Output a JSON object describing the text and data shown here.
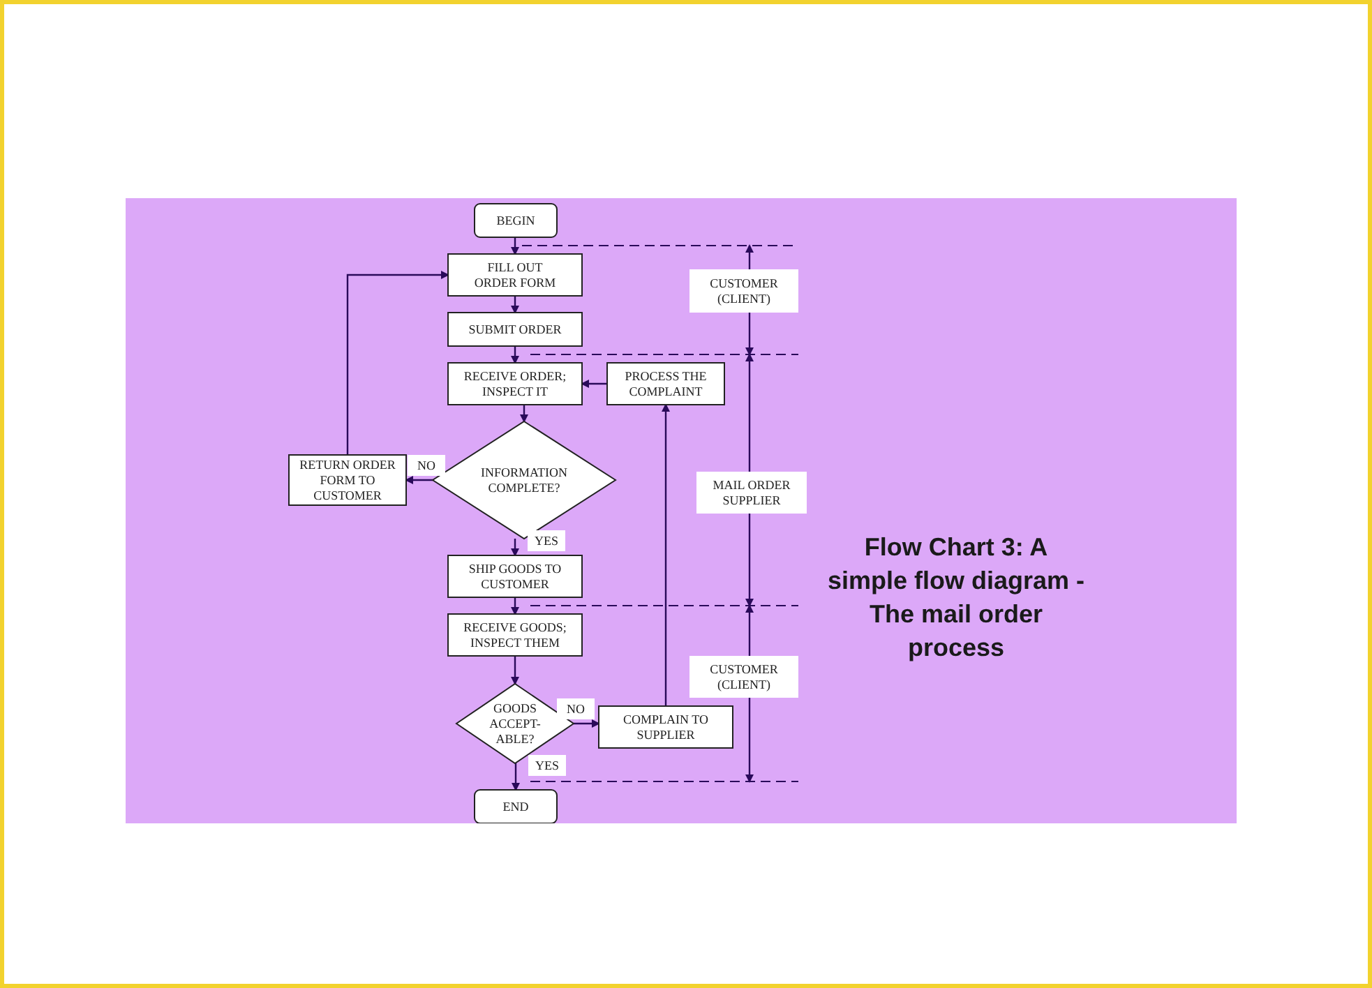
{
  "title": "Flow Chart 3:  A simple flow diagram - The mail order process",
  "nodes": [
    {
      "kind": "terminal",
      "lines": [
        "BEGIN"
      ]
    },
    {
      "kind": "process",
      "lines": [
        "FILL OUT",
        "ORDER FORM"
      ]
    },
    {
      "kind": "process",
      "lines": [
        "SUBMIT ORDER"
      ]
    },
    {
      "kind": "process",
      "lines": [
        "RECEIVE ORDER;",
        "INSPECT IT"
      ]
    },
    {
      "kind": "process",
      "lines": [
        "PROCESS THE",
        "COMPLAINT"
      ]
    },
    {
      "kind": "process",
      "lines": [
        "RETURN ORDER",
        "FORM TO",
        "CUSTOMER"
      ]
    },
    {
      "kind": "decision",
      "lines": [
        "INFORMATION",
        "COMPLETE?"
      ]
    },
    {
      "kind": "process",
      "lines": [
        "SHIP GOODS TO",
        "CUSTOMER"
      ]
    },
    {
      "kind": "process",
      "lines": [
        "RECEIVE GOODS;",
        "INSPECT THEM"
      ]
    },
    {
      "kind": "decision",
      "lines": [
        "GOODS",
        "ACCEPT-",
        "ABLE?"
      ]
    },
    {
      "kind": "process",
      "lines": [
        "COMPLAIN TO",
        "SUPPLIER"
      ]
    },
    {
      "kind": "terminal",
      "lines": [
        "END"
      ]
    }
  ],
  "branch_labels": [
    "NO",
    "YES",
    "NO",
    "YES"
  ],
  "lanes": [
    {
      "lines": [
        "CUSTOMER",
        "(CLIENT)"
      ]
    },
    {
      "lines": [
        "MAIL ORDER",
        "SUPPLIER"
      ]
    },
    {
      "lines": [
        "CUSTOMER",
        "(CLIENT)"
      ]
    }
  ]
}
